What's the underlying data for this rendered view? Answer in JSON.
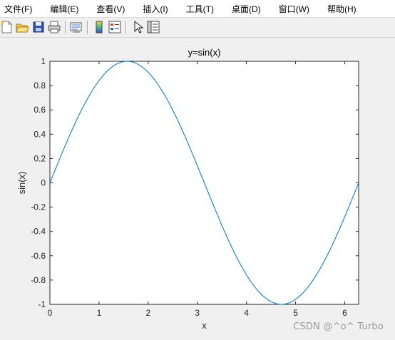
{
  "menu": [
    {
      "label": "文件(F)"
    },
    {
      "label": "编辑(E)"
    },
    {
      "label": "查看(V)"
    },
    {
      "label": "插入(I)"
    },
    {
      "label": "工具(T)"
    },
    {
      "label": "桌面(D)"
    },
    {
      "label": "窗口(W)"
    },
    {
      "label": "帮助(H)"
    }
  ],
  "toolbar": {
    "icons": [
      "new-figure-icon",
      "open-file-icon",
      "save-icon",
      "print-icon",
      "link-plot-icon",
      "colorbar-icon",
      "legend-icon",
      "edit-plot-arrow-icon",
      "property-inspector-icon"
    ]
  },
  "chart_data": {
    "type": "line",
    "title": "y=sin(x)",
    "xlabel": "x",
    "ylabel": "sin(x)",
    "xlim": [
      0,
      6.2832
    ],
    "ylim": [
      -1,
      1
    ],
    "xticks": [
      "0",
      "1",
      "2",
      "3",
      "4",
      "5",
      "6"
    ],
    "yticks": [
      "-1",
      "-0.8",
      "-0.6",
      "-0.4",
      "-0.2",
      "0",
      "0.2",
      "0.4",
      "0.6",
      "0.8",
      "1"
    ],
    "grid": false,
    "line_color": "#0072bd",
    "series": [
      {
        "x": [
          0,
          0.3142,
          0.6283,
          0.9425,
          1.2566,
          1.5708,
          1.885,
          2.1991,
          2.5133,
          2.8274,
          3.1416,
          3.4558,
          3.7699,
          4.0841,
          4.3982,
          4.7124,
          5.0265,
          5.3407,
          5.6549,
          5.969,
          6.2832
        ],
        "values": [
          0,
          0.309,
          0.5878,
          0.809,
          0.9511,
          1,
          0.9511,
          0.809,
          0.5878,
          0.309,
          0,
          -0.309,
          -0.5878,
          -0.809,
          -0.9511,
          -1,
          -0.9511,
          -0.809,
          -0.5878,
          -0.309,
          0
        ]
      }
    ]
  },
  "watermark": "CSDN @^o^ Turbo"
}
